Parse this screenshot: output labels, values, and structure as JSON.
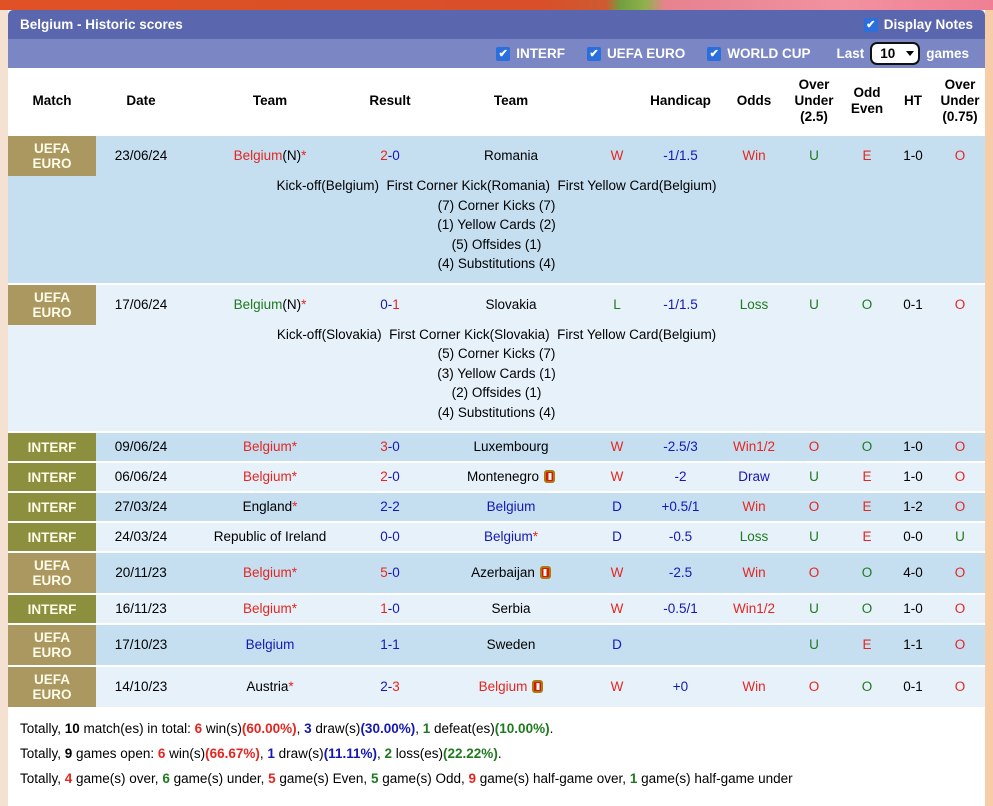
{
  "colors": {
    "title_bar": "#5a66ad",
    "toolbar_bar": "#7b86c4",
    "badge_gold": "#ab9760",
    "badge_olive": "#8b8f3e",
    "row_medium_blue": "#c5dff1",
    "row_light_blue": "#e7f1fa",
    "win_red": "#e52620",
    "draw_blue": "#1418b4",
    "loss_green": "#1f7a1f",
    "checkbox_blue": "#2b6fdd"
  },
  "header": {
    "title": "Belgium - Historic scores",
    "display_notes_label": "Display Notes",
    "display_notes_checked": true
  },
  "toolbar": {
    "filters": [
      {
        "label": "INTERF",
        "checked": true
      },
      {
        "label": "UEFA EURO",
        "checked": true
      },
      {
        "label": "WORLD CUP",
        "checked": true
      }
    ],
    "last_label": "Last",
    "games_count": "10",
    "games_label": "games"
  },
  "table": {
    "headers": [
      "Match",
      "Date",
      "Team",
      "Result",
      "Team",
      "",
      "Handicap",
      "Odds",
      "Over Under (2.5)",
      "Odd Even",
      "HT",
      "Over Under (0.75)"
    ],
    "star_symbol": "*",
    "score_separator": "-",
    "rows": [
      {
        "competition": "UEFA EURO",
        "badge_style": "gold",
        "date": "23/06/24",
        "home_team": {
          "name": "Belgium",
          "note": "(N)",
          "star": true,
          "color": "red"
        },
        "score": {
          "home": "2",
          "home_color": "red",
          "away": "0",
          "away_color": "blue"
        },
        "away_team": {
          "name": "Romania",
          "star": false,
          "red_card": false,
          "color": "black"
        },
        "outcome": {
          "text": "W",
          "color": "red"
        },
        "handicap": "-1/1.5",
        "odds": {
          "text": "Win",
          "color": "red"
        },
        "over_under_25": {
          "text": "U",
          "color": "green"
        },
        "odd_even": {
          "text": "E",
          "color": "red"
        },
        "half_time": "1-0",
        "over_under_075": {
          "text": "O",
          "color": "red"
        },
        "notes": [
          "Kick-off(Belgium)  First Corner Kick(Romania)  First Yellow Card(Belgium)",
          "(7) Corner Kicks (7)",
          "(1) Yellow Cards (2)",
          "(5) Offsides (1)",
          "(4) Substitutions (4)"
        ]
      },
      {
        "competition": "UEFA EURO",
        "badge_style": "gold",
        "date": "17/06/24",
        "home_team": {
          "name": "Belgium",
          "note": "(N)",
          "star": true,
          "color": "green"
        },
        "score": {
          "home": "0",
          "home_color": "blue",
          "away": "1",
          "away_color": "red"
        },
        "away_team": {
          "name": "Slovakia",
          "star": false,
          "red_card": false,
          "color": "black"
        },
        "outcome": {
          "text": "L",
          "color": "green"
        },
        "handicap": "-1/1.5",
        "odds": {
          "text": "Loss",
          "color": "green"
        },
        "over_under_25": {
          "text": "U",
          "color": "green"
        },
        "odd_even": {
          "text": "O",
          "color": "green"
        },
        "half_time": "0-1",
        "over_under_075": {
          "text": "O",
          "color": "red"
        },
        "notes": [
          "Kick-off(Slovakia)  First Corner Kick(Slovakia)  First Yellow Card(Belgium)",
          "(5) Corner Kicks (7)",
          "(3) Yellow Cards (1)",
          "(2) Offsides (1)",
          "(4) Substitutions (4)"
        ]
      },
      {
        "competition": "INTERF",
        "badge_style": "olive",
        "date": "09/06/24",
        "home_team": {
          "name": "Belgium",
          "note": "",
          "star": true,
          "color": "red"
        },
        "score": {
          "home": "3",
          "home_color": "red",
          "away": "0",
          "away_color": "blue"
        },
        "away_team": {
          "name": "Luxembourg",
          "star": false,
          "red_card": false,
          "color": "black"
        },
        "outcome": {
          "text": "W",
          "color": "red"
        },
        "handicap": "-2.5/3",
        "odds": {
          "text": "Win1/2",
          "color": "red"
        },
        "over_under_25": {
          "text": "O",
          "color": "red"
        },
        "odd_even": {
          "text": "O",
          "color": "green"
        },
        "half_time": "1-0",
        "over_under_075": {
          "text": "O",
          "color": "red"
        },
        "notes": null
      },
      {
        "competition": "INTERF",
        "badge_style": "olive",
        "date": "06/06/24",
        "home_team": {
          "name": "Belgium",
          "note": "",
          "star": true,
          "color": "red"
        },
        "score": {
          "home": "2",
          "home_color": "red",
          "away": "0",
          "away_color": "blue"
        },
        "away_team": {
          "name": "Montenegro",
          "star": false,
          "red_card": true,
          "color": "black"
        },
        "outcome": {
          "text": "W",
          "color": "red"
        },
        "handicap": "-2",
        "odds": {
          "text": "Draw",
          "color": "blue"
        },
        "over_under_25": {
          "text": "U",
          "color": "green"
        },
        "odd_even": {
          "text": "E",
          "color": "red"
        },
        "half_time": "1-0",
        "over_under_075": {
          "text": "O",
          "color": "red"
        },
        "notes": null
      },
      {
        "competition": "INTERF",
        "badge_style": "olive",
        "date": "27/03/24",
        "home_team": {
          "name": "England",
          "note": "",
          "star": true,
          "color": "black"
        },
        "score": {
          "home": "2",
          "home_color": "blue",
          "away": "2",
          "away_color": "blue"
        },
        "away_team": {
          "name": "Belgium",
          "star": false,
          "red_card": false,
          "color": "blue"
        },
        "outcome": {
          "text": "D",
          "color": "blue"
        },
        "handicap": "+0.5/1",
        "odds": {
          "text": "Win",
          "color": "red"
        },
        "over_under_25": {
          "text": "O",
          "color": "red"
        },
        "odd_even": {
          "text": "E",
          "color": "red"
        },
        "half_time": "1-2",
        "over_under_075": {
          "text": "O",
          "color": "red"
        },
        "notes": null
      },
      {
        "competition": "INTERF",
        "badge_style": "olive",
        "date": "24/03/24",
        "home_team": {
          "name": "Republic of Ireland",
          "note": "",
          "star": false,
          "color": "black"
        },
        "score": {
          "home": "0",
          "home_color": "blue",
          "away": "0",
          "away_color": "blue"
        },
        "away_team": {
          "name": "Belgium",
          "star": true,
          "red_card": false,
          "color": "blue"
        },
        "outcome": {
          "text": "D",
          "color": "blue"
        },
        "handicap": "-0.5",
        "odds": {
          "text": "Loss",
          "color": "green"
        },
        "over_under_25": {
          "text": "U",
          "color": "green"
        },
        "odd_even": {
          "text": "E",
          "color": "red"
        },
        "half_time": "0-0",
        "over_under_075": {
          "text": "U",
          "color": "green"
        },
        "notes": null
      },
      {
        "competition": "UEFA EURO",
        "badge_style": "gold",
        "date": "20/11/23",
        "home_team": {
          "name": "Belgium",
          "note": "",
          "star": true,
          "color": "red"
        },
        "score": {
          "home": "5",
          "home_color": "red",
          "away": "0",
          "away_color": "blue"
        },
        "away_team": {
          "name": "Azerbaijan",
          "star": false,
          "red_card": true,
          "color": "black"
        },
        "outcome": {
          "text": "W",
          "color": "red"
        },
        "handicap": "-2.5",
        "odds": {
          "text": "Win",
          "color": "red"
        },
        "over_under_25": {
          "text": "O",
          "color": "red"
        },
        "odd_even": {
          "text": "O",
          "color": "green"
        },
        "half_time": "4-0",
        "over_under_075": {
          "text": "O",
          "color": "red"
        },
        "notes": null
      },
      {
        "competition": "INTERF",
        "badge_style": "olive",
        "date": "16/11/23",
        "home_team": {
          "name": "Belgium",
          "note": "",
          "star": true,
          "color": "red"
        },
        "score": {
          "home": "1",
          "home_color": "red",
          "away": "0",
          "away_color": "blue"
        },
        "away_team": {
          "name": "Serbia",
          "star": false,
          "red_card": false,
          "color": "black"
        },
        "outcome": {
          "text": "W",
          "color": "red"
        },
        "handicap": "-0.5/1",
        "odds": {
          "text": "Win1/2",
          "color": "red"
        },
        "over_under_25": {
          "text": "U",
          "color": "green"
        },
        "odd_even": {
          "text": "O",
          "color": "green"
        },
        "half_time": "1-0",
        "over_under_075": {
          "text": "O",
          "color": "red"
        },
        "notes": null
      },
      {
        "competition": "UEFA EURO",
        "badge_style": "gold",
        "date": "17/10/23",
        "home_team": {
          "name": "Belgium",
          "note": "",
          "star": false,
          "color": "blue"
        },
        "score": {
          "home": "1",
          "home_color": "blue",
          "away": "1",
          "away_color": "blue"
        },
        "away_team": {
          "name": "Sweden",
          "star": false,
          "red_card": false,
          "color": "black"
        },
        "outcome": {
          "text": "D",
          "color": "blue"
        },
        "handicap": "",
        "odds": {
          "text": "",
          "color": "black"
        },
        "over_under_25": {
          "text": "U",
          "color": "green"
        },
        "odd_even": {
          "text": "E",
          "color": "red"
        },
        "half_time": "1-1",
        "over_under_075": {
          "text": "O",
          "color": "red"
        },
        "notes": null
      },
      {
        "competition": "UEFA EURO",
        "badge_style": "gold",
        "date": "14/10/23",
        "home_team": {
          "name": "Austria",
          "note": "",
          "star": true,
          "color": "black"
        },
        "score": {
          "home": "2",
          "home_color": "blue",
          "away": "3",
          "away_color": "red"
        },
        "away_team": {
          "name": "Belgium",
          "star": false,
          "red_card": true,
          "color": "red"
        },
        "outcome": {
          "text": "W",
          "color": "red"
        },
        "handicap": "+0",
        "odds": {
          "text": "Win",
          "color": "red"
        },
        "over_under_25": {
          "text": "O",
          "color": "red"
        },
        "odd_even": {
          "text": "O",
          "color": "green"
        },
        "half_time": "0-1",
        "over_under_075": {
          "text": "O",
          "color": "red"
        },
        "notes": null
      }
    ]
  },
  "footer": {
    "lines": [
      [
        {
          "t": "Totally, "
        },
        {
          "t": "10",
          "bold": true
        },
        {
          "t": " match(es) in total: "
        },
        {
          "t": "6",
          "bold": true,
          "color": "red"
        },
        {
          "t": " win(s)"
        },
        {
          "t": "(60.00%)",
          "bold": true,
          "color": "red"
        },
        {
          "t": ", "
        },
        {
          "t": "3",
          "bold": true,
          "color": "blue"
        },
        {
          "t": " draw(s)"
        },
        {
          "t": "(30.00%)",
          "bold": true,
          "color": "blue"
        },
        {
          "t": ", "
        },
        {
          "t": "1",
          "bold": true,
          "color": "green"
        },
        {
          "t": " defeat(es)"
        },
        {
          "t": "(10.00%)",
          "bold": true,
          "color": "green"
        },
        {
          "t": "."
        }
      ],
      [
        {
          "t": "Totally, "
        },
        {
          "t": "9",
          "bold": true
        },
        {
          "t": " games open: "
        },
        {
          "t": "6",
          "bold": true,
          "color": "red"
        },
        {
          "t": " win(s)"
        },
        {
          "t": "(66.67%)",
          "bold": true,
          "color": "red"
        },
        {
          "t": ", "
        },
        {
          "t": "1",
          "bold": true,
          "color": "blue"
        },
        {
          "t": " draw(s)"
        },
        {
          "t": "(11.11%)",
          "bold": true,
          "color": "blue"
        },
        {
          "t": ", "
        },
        {
          "t": "2",
          "bold": true,
          "color": "green"
        },
        {
          "t": " loss(es)"
        },
        {
          "t": "(22.22%)",
          "bold": true,
          "color": "green"
        },
        {
          "t": "."
        }
      ],
      [
        {
          "t": "Totally, "
        },
        {
          "t": "4",
          "bold": true,
          "color": "red"
        },
        {
          "t": " game(s) over, "
        },
        {
          "t": "6",
          "bold": true,
          "color": "green"
        },
        {
          "t": " game(s) under, "
        },
        {
          "t": "5",
          "bold": true,
          "color": "red"
        },
        {
          "t": " game(s) Even, "
        },
        {
          "t": "5",
          "bold": true,
          "color": "green"
        },
        {
          "t": " game(s) Odd, "
        },
        {
          "t": "9",
          "bold": true,
          "color": "red"
        },
        {
          "t": " game(s) half-game over, "
        },
        {
          "t": "1",
          "bold": true,
          "color": "green"
        },
        {
          "t": " game(s) half-game under"
        }
      ]
    ]
  }
}
